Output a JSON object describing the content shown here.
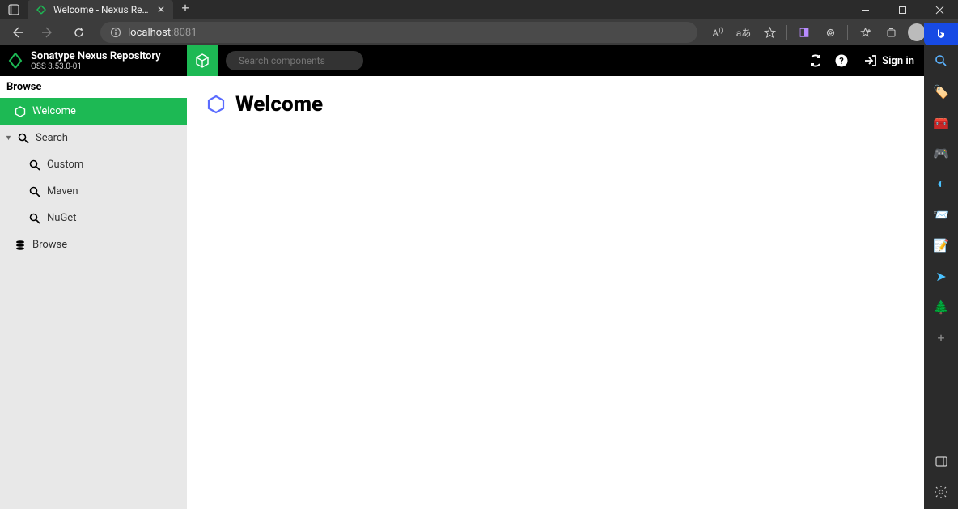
{
  "browser": {
    "tab_title": "Welcome - Nexus Repository M...",
    "url_host": "localhost",
    "url_port": ":8081"
  },
  "nexus": {
    "product_name": "Sonatype Nexus Repository",
    "version": "OSS 3.53.0-01",
    "search_placeholder": "Search components",
    "signin_label": "Sign in",
    "page_title": "Welcome"
  },
  "sidebar": {
    "section": "Browse",
    "items": [
      {
        "label": "Welcome"
      },
      {
        "label": "Search"
      },
      {
        "label": "Custom"
      },
      {
        "label": "Maven"
      },
      {
        "label": "NuGet"
      },
      {
        "label": "Browse"
      }
    ]
  }
}
